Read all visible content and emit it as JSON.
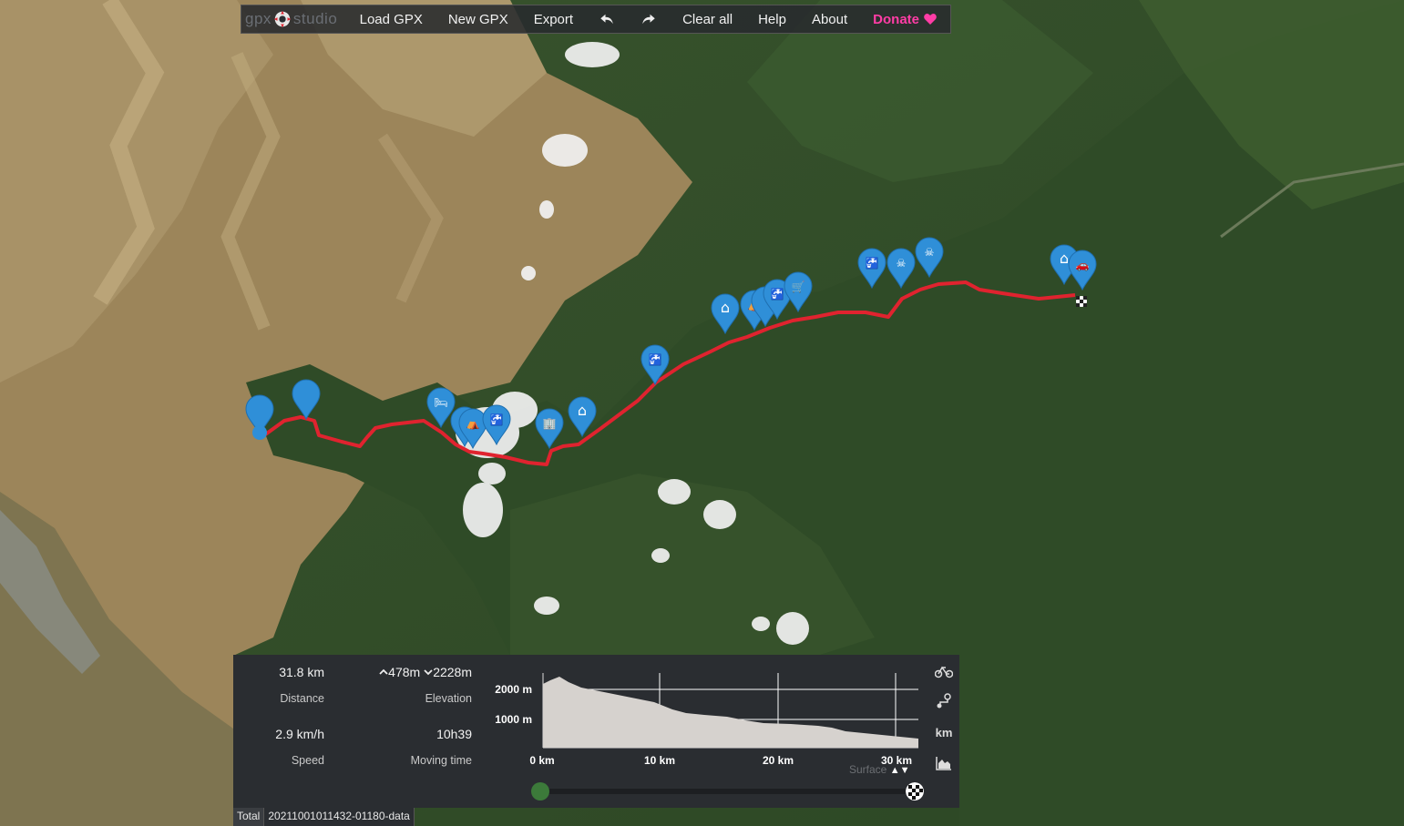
{
  "toolbar": {
    "logo_text_a": "gpx",
    "logo_text_b": "studio",
    "items": [
      {
        "label": "Load GPX"
      },
      {
        "label": "New GPX"
      },
      {
        "label": "Export"
      },
      {
        "label": "Clear all"
      },
      {
        "label": "Help"
      },
      {
        "label": "About"
      }
    ],
    "donate_label": "Donate"
  },
  "stats": {
    "distance_value": "31.8 km",
    "distance_label": "Distance",
    "elevation_up": "478m",
    "elevation_down": "2228m",
    "elevation_label": "Elevation",
    "speed_value": "2.9 km/h",
    "speed_label": "Speed",
    "moving_time_value": "10h39",
    "moving_time_label": "Moving time"
  },
  "elevation_chart": {
    "y_ticks": [
      "2000 m",
      "1000 m"
    ],
    "x_ticks": [
      "0 km",
      "10 km",
      "20 km",
      "30 km"
    ],
    "surface_label": "Surface"
  },
  "side_icons": {
    "units_label": "km"
  },
  "tabs": [
    {
      "label": "Total"
    },
    {
      "label": "20211001011432-01180-data"
    }
  ],
  "colors": {
    "track": "#e0232f",
    "marker": "#2f8fd8",
    "donate": "#ff3da6"
  }
}
